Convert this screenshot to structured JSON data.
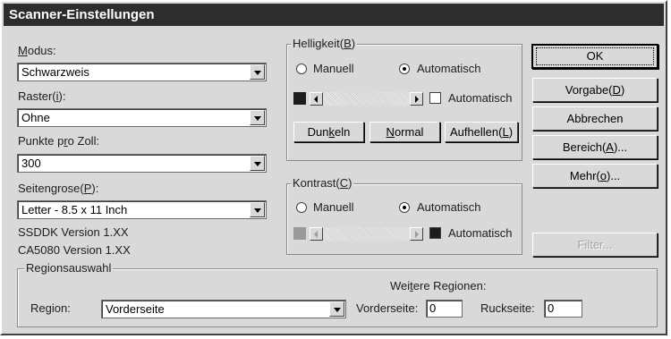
{
  "window": {
    "title": "Scanner-Einstellungen"
  },
  "left": {
    "modus": {
      "label_pre": "",
      "label_key": "M",
      "label_post": "odus:",
      "value": "Schwarzweis"
    },
    "raster": {
      "label_pre": "Raster(",
      "label_key": "i",
      "label_post": "):",
      "value": "Ohne"
    },
    "dpi": {
      "label_pre": "Punkte p",
      "label_key": "r",
      "label_post": "o Zoll:",
      "value": "300"
    },
    "pagesize": {
      "label_pre": "Seitengrose(",
      "label_key": "P",
      "label_post": "):",
      "value": "Letter - 8.5 x 11 Inch"
    },
    "version1": "SSDDK Version 1.XX",
    "version2": "CA5080 Version 1.XX"
  },
  "brightness": {
    "title_pre": "Helligkeit(",
    "title_key": "B",
    "title_post": ")",
    "manual": "Manuell",
    "auto": "Automatisch",
    "selected": "Automatisch",
    "auto_check_label": "Automatisch",
    "buttons": {
      "dark_pre": "Dun",
      "dark_key": "k",
      "dark_post": "eln",
      "normal_pre": "",
      "normal_key": "N",
      "normal_post": "ormal",
      "light_pre": "Aufhellen(",
      "light_key": "L",
      "light_post": ")"
    }
  },
  "contrast": {
    "title_pre": "Kontrast(",
    "title_key": "C",
    "title_post": ")",
    "manual": "Manuell",
    "auto": "Automatisch",
    "selected": "Automatisch",
    "auto_check_label": "Automatisch"
  },
  "buttons": {
    "ok": "OK",
    "default_pre": "Vorgabe(",
    "default_key": "D",
    "default_post": ")",
    "cancel": "Abbrechen",
    "area_pre": "Bereich(",
    "area_key": "A",
    "area_post": ")...",
    "more_pre": "Mehr(",
    "more_key": "o",
    "more_post": ")...",
    "filter": "Filter..."
  },
  "region": {
    "group_title": "Regionsauswahl",
    "region_label": "Region:",
    "region_value": "Vorderseite",
    "more_regions_pre": "Wei",
    "more_regions_key": "t",
    "more_regions_post": "ere Regionen:",
    "front_label": "Vorderseite:",
    "front_value": "0",
    "back_label": "Ruckseite:",
    "back_value": "0"
  },
  "colors": {
    "titlebar": "#2d2d2d",
    "dialog": "#d9d9d9"
  }
}
